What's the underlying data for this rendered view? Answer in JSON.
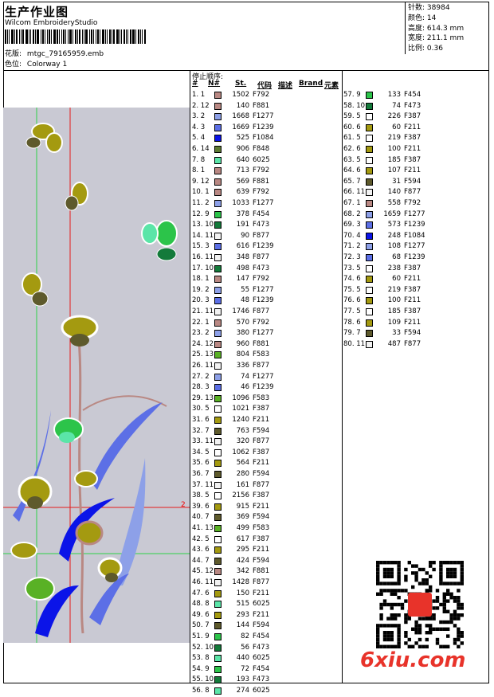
{
  "header": {
    "title": "生产作业图",
    "company": "Wilcom EmbroideryStudio",
    "pattern_label": "花版:",
    "pattern_value": "mtgc_79165959.emb",
    "color_label": "色位:",
    "color_value": "Colorway 1"
  },
  "stats": {
    "stitches_label": "针数:",
    "stitches": "38984",
    "colors_label": "颜色:",
    "colors": "14",
    "height_label": "高度:",
    "height": "614.3 mm",
    "width_label": "宽度:",
    "width": "211.1 mm",
    "scale_label": "比例:",
    "scale": "0.36"
  },
  "stop_sequence": {
    "title": "停止顺序:",
    "headers": {
      "idx": "#",
      "no": "N#",
      "st": "St.",
      "code": "代码",
      "desc": "描述",
      "brand": "Brand",
      "element": "元素"
    }
  },
  "rows": [
    {
      "n": "1.",
      "k": "1",
      "st": "1502",
      "c": "F792",
      "col": "#b98883"
    },
    {
      "n": "2.",
      "k": "12",
      "st": "140",
      "c": "F881",
      "col": "#b98883"
    },
    {
      "n": "3.",
      "k": "2",
      "st": "1668",
      "c": "F1277",
      "col": "#8da0e8"
    },
    {
      "n": "4.",
      "k": "3",
      "st": "1669",
      "c": "F1239",
      "col": "#5c6fe6"
    },
    {
      "n": "5.",
      "k": "4",
      "st": "525",
      "c": "F1084",
      "col": "#0b14e8"
    },
    {
      "n": "6.",
      "k": "14",
      "st": "906",
      "c": "F848",
      "col": "#5d7a32"
    },
    {
      "n": "7.",
      "k": "8",
      "st": "640",
      "c": "6025",
      "col": "#5be5a8"
    },
    {
      "n": "8.",
      "k": "1",
      "st": "713",
      "c": "F792",
      "col": "#b98883"
    },
    {
      "n": "9.",
      "k": "12",
      "st": "569",
      "c": "F881",
      "col": "#b98883"
    },
    {
      "n": "10.",
      "k": "1",
      "st": "639",
      "c": "F792",
      "col": "#b98883"
    },
    {
      "n": "11.",
      "k": "2",
      "st": "1033",
      "c": "F1277",
      "col": "#8da0e8"
    },
    {
      "n": "12.",
      "k": "9",
      "st": "378",
      "c": "F454",
      "col": "#2cc44a"
    },
    {
      "n": "13.",
      "k": "10",
      "st": "191",
      "c": "F473",
      "col": "#137a3a"
    },
    {
      "n": "14.",
      "k": "11",
      "st": "90",
      "c": "F877",
      "col": "#f2f2f2"
    },
    {
      "n": "15.",
      "k": "3",
      "st": "616",
      "c": "F1239",
      "col": "#5c6fe6"
    },
    {
      "n": "16.",
      "k": "11",
      "st": "348",
      "c": "F877",
      "col": "#f2f2f2"
    },
    {
      "n": "17.",
      "k": "10",
      "st": "498",
      "c": "F473",
      "col": "#137a3a"
    },
    {
      "n": "18.",
      "k": "1",
      "st": "147",
      "c": "F792",
      "col": "#b98883"
    },
    {
      "n": "19.",
      "k": "2",
      "st": "55",
      "c": "F1277",
      "col": "#8da0e8"
    },
    {
      "n": "20.",
      "k": "3",
      "st": "48",
      "c": "F1239",
      "col": "#5c6fe6"
    },
    {
      "n": "21.",
      "k": "11",
      "st": "1746",
      "c": "F877",
      "col": "#f2f2f2"
    },
    {
      "n": "22.",
      "k": "1",
      "st": "570",
      "c": "F792",
      "col": "#b98883"
    },
    {
      "n": "23.",
      "k": "2",
      "st": "380",
      "c": "F1277",
      "col": "#8da0e8"
    },
    {
      "n": "24.",
      "k": "12",
      "st": "960",
      "c": "F881",
      "col": "#b98883"
    },
    {
      "n": "25.",
      "k": "13",
      "st": "804",
      "c": "F583",
      "col": "#59b125"
    },
    {
      "n": "26.",
      "k": "11",
      "st": "336",
      "c": "F877",
      "col": "#f2f2f2"
    },
    {
      "n": "27.",
      "k": "2",
      "st": "74",
      "c": "F1277",
      "col": "#8da0e8"
    },
    {
      "n": "28.",
      "k": "3",
      "st": "46",
      "c": "F1239",
      "col": "#5c6fe6"
    },
    {
      "n": "29.",
      "k": "13",
      "st": "1096",
      "c": "F583",
      "col": "#59b125"
    },
    {
      "n": "30.",
      "k": "5",
      "st": "1021",
      "c": "F387",
      "col": "#ffffff"
    },
    {
      "n": "31.",
      "k": "6",
      "st": "1240",
      "c": "F211",
      "col": "#a49a10"
    },
    {
      "n": "32.",
      "k": "7",
      "st": "763",
      "c": "F594",
      "col": "#5e5a2c"
    },
    {
      "n": "33.",
      "k": "11",
      "st": "320",
      "c": "F877",
      "col": "#f2f2f2"
    },
    {
      "n": "34.",
      "k": "5",
      "st": "1062",
      "c": "F387",
      "col": "#ffffff"
    },
    {
      "n": "35.",
      "k": "6",
      "st": "564",
      "c": "F211",
      "col": "#a49a10"
    },
    {
      "n": "36.",
      "k": "7",
      "st": "280",
      "c": "F594",
      "col": "#5e5a2c"
    },
    {
      "n": "37.",
      "k": "11",
      "st": "161",
      "c": "F877",
      "col": "#f2f2f2"
    },
    {
      "n": "38.",
      "k": "5",
      "st": "2156",
      "c": "F387",
      "col": "#ffffff"
    },
    {
      "n": "39.",
      "k": "6",
      "st": "915",
      "c": "F211",
      "col": "#a49a10"
    },
    {
      "n": "40.",
      "k": "7",
      "st": "369",
      "c": "F594",
      "col": "#5e5a2c"
    },
    {
      "n": "41.",
      "k": "13",
      "st": "499",
      "c": "F583",
      "col": "#59b125"
    },
    {
      "n": "42.",
      "k": "5",
      "st": "617",
      "c": "F387",
      "col": "#ffffff"
    },
    {
      "n": "43.",
      "k": "6",
      "st": "295",
      "c": "F211",
      "col": "#a49a10"
    },
    {
      "n": "44.",
      "k": "7",
      "st": "424",
      "c": "F594",
      "col": "#5e5a2c"
    },
    {
      "n": "45.",
      "k": "12",
      "st": "342",
      "c": "F881",
      "col": "#b98883"
    },
    {
      "n": "46.",
      "k": "11",
      "st": "1428",
      "c": "F877",
      "col": "#f2f2f2"
    },
    {
      "n": "47.",
      "k": "6",
      "st": "150",
      "c": "F211",
      "col": "#a49a10"
    },
    {
      "n": "48.",
      "k": "8",
      "st": "515",
      "c": "6025",
      "col": "#5be5a8"
    },
    {
      "n": "49.",
      "k": "6",
      "st": "293",
      "c": "F211",
      "col": "#a49a10"
    },
    {
      "n": "50.",
      "k": "7",
      "st": "144",
      "c": "F594",
      "col": "#5e5a2c"
    },
    {
      "n": "51.",
      "k": "9",
      "st": "82",
      "c": "F454",
      "col": "#2cc44a"
    },
    {
      "n": "52.",
      "k": "10",
      "st": "56",
      "c": "F473",
      "col": "#137a3a"
    },
    {
      "n": "53.",
      "k": "8",
      "st": "440",
      "c": "6025",
      "col": "#5be5a8"
    },
    {
      "n": "54.",
      "k": "9",
      "st": "72",
      "c": "F454",
      "col": "#2cc44a"
    },
    {
      "n": "55.",
      "k": "10",
      "st": "193",
      "c": "F473",
      "col": "#137a3a"
    },
    {
      "n": "56.",
      "k": "8",
      "st": "274",
      "c": "6025",
      "col": "#5be5a8"
    },
    {
      "n": "57.",
      "k": "9",
      "st": "133",
      "c": "F454",
      "col": "#2cc44a"
    },
    {
      "n": "58.",
      "k": "10",
      "st": "74",
      "c": "F473",
      "col": "#137a3a"
    },
    {
      "n": "59.",
      "k": "5",
      "st": "226",
      "c": "F387",
      "col": "#ffffff"
    },
    {
      "n": "60.",
      "k": "6",
      "st": "60",
      "c": "F211",
      "col": "#a49a10"
    },
    {
      "n": "61.",
      "k": "5",
      "st": "219",
      "c": "F387",
      "col": "#ffffff"
    },
    {
      "n": "62.",
      "k": "6",
      "st": "100",
      "c": "F211",
      "col": "#a49a10"
    },
    {
      "n": "63.",
      "k": "5",
      "st": "185",
      "c": "F387",
      "col": "#ffffff"
    },
    {
      "n": "64.",
      "k": "6",
      "st": "107",
      "c": "F211",
      "col": "#a49a10"
    },
    {
      "n": "65.",
      "k": "7",
      "st": "31",
      "c": "F594",
      "col": "#5e5a2c"
    },
    {
      "n": "66.",
      "k": "11",
      "st": "140",
      "c": "F877",
      "col": "#f2f2f2"
    },
    {
      "n": "67.",
      "k": "1",
      "st": "558",
      "c": "F792",
      "col": "#b98883"
    },
    {
      "n": "68.",
      "k": "2",
      "st": "1659",
      "c": "F1277",
      "col": "#8da0e8"
    },
    {
      "n": "69.",
      "k": "3",
      "st": "573",
      "c": "F1239",
      "col": "#5c6fe6"
    },
    {
      "n": "70.",
      "k": "4",
      "st": "248",
      "c": "F1084",
      "col": "#0b14e8"
    },
    {
      "n": "71.",
      "k": "2",
      "st": "108",
      "c": "F1277",
      "col": "#8da0e8"
    },
    {
      "n": "72.",
      "k": "3",
      "st": "68",
      "c": "F1239",
      "col": "#5c6fe6"
    },
    {
      "n": "73.",
      "k": "5",
      "st": "238",
      "c": "F387",
      "col": "#ffffff"
    },
    {
      "n": "74.",
      "k": "6",
      "st": "60",
      "c": "F211",
      "col": "#a49a10"
    },
    {
      "n": "75.",
      "k": "5",
      "st": "219",
      "c": "F387",
      "col": "#ffffff"
    },
    {
      "n": "76.",
      "k": "6",
      "st": "100",
      "c": "F211",
      "col": "#a49a10"
    },
    {
      "n": "77.",
      "k": "5",
      "st": "185",
      "c": "F387",
      "col": "#ffffff"
    },
    {
      "n": "78.",
      "k": "6",
      "st": "109",
      "c": "F211",
      "col": "#a49a10"
    },
    {
      "n": "79.",
      "k": "7",
      "st": "33",
      "c": "F594",
      "col": "#5e5a2c"
    },
    {
      "n": "80.",
      "k": "11",
      "st": "487",
      "c": "F877",
      "col": "#f2f2f2"
    }
  ],
  "preview": {
    "marker": "2"
  },
  "footer": {
    "brand": "6xiu.com"
  },
  "colors": {
    "guide_red": "#e51b1b",
    "guide_green": "#2fd14a",
    "preview_bg": "#c9c9d3",
    "brand_red": "#e8332a"
  }
}
